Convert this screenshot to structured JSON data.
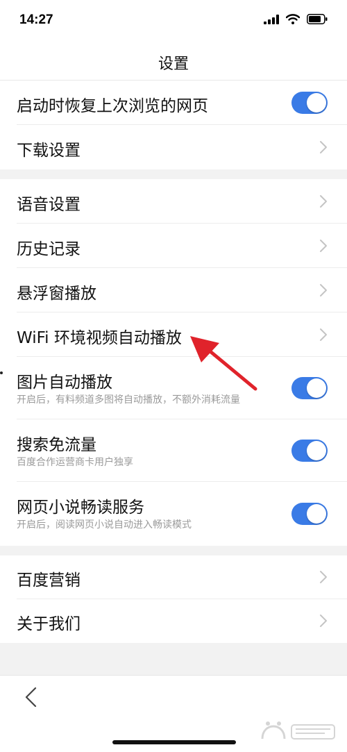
{
  "status": {
    "time": "14:27"
  },
  "header": {
    "title": "设置"
  },
  "groups": [
    [
      {
        "label": "启动时恢复上次浏览的网页",
        "control": "toggle",
        "on": true
      },
      {
        "label": "下载设置",
        "control": "chevron"
      }
    ],
    [
      {
        "label": "语音设置",
        "control": "chevron"
      },
      {
        "label": "历史记录",
        "control": "chevron"
      },
      {
        "label": "悬浮窗播放",
        "control": "chevron"
      },
      {
        "label": "WiFi 环境视频自动播放",
        "control": "chevron"
      },
      {
        "label": "图片自动播放",
        "sub": "开启后，有料频道多图将自动播放，不额外消耗流量",
        "control": "toggle",
        "on": true
      },
      {
        "label": "搜索免流量",
        "sub": "百度合作运营商卡用户独享",
        "control": "toggle",
        "on": true
      },
      {
        "label": "网页小说畅读服务",
        "sub": "开启后，阅读网页小说自动进入畅读模式",
        "control": "toggle",
        "on": true
      }
    ],
    [
      {
        "label": "百度营销",
        "control": "chevron"
      },
      {
        "label": "关于我们",
        "control": "chevron"
      }
    ]
  ],
  "colors": {
    "toggle_on": "#3a7be6",
    "section_gap": "#f2f2f2",
    "annotation_arrow": "#e0232b"
  },
  "icons": {
    "back": "chevron-left-icon",
    "row_chevron": "chevron-right-icon"
  }
}
